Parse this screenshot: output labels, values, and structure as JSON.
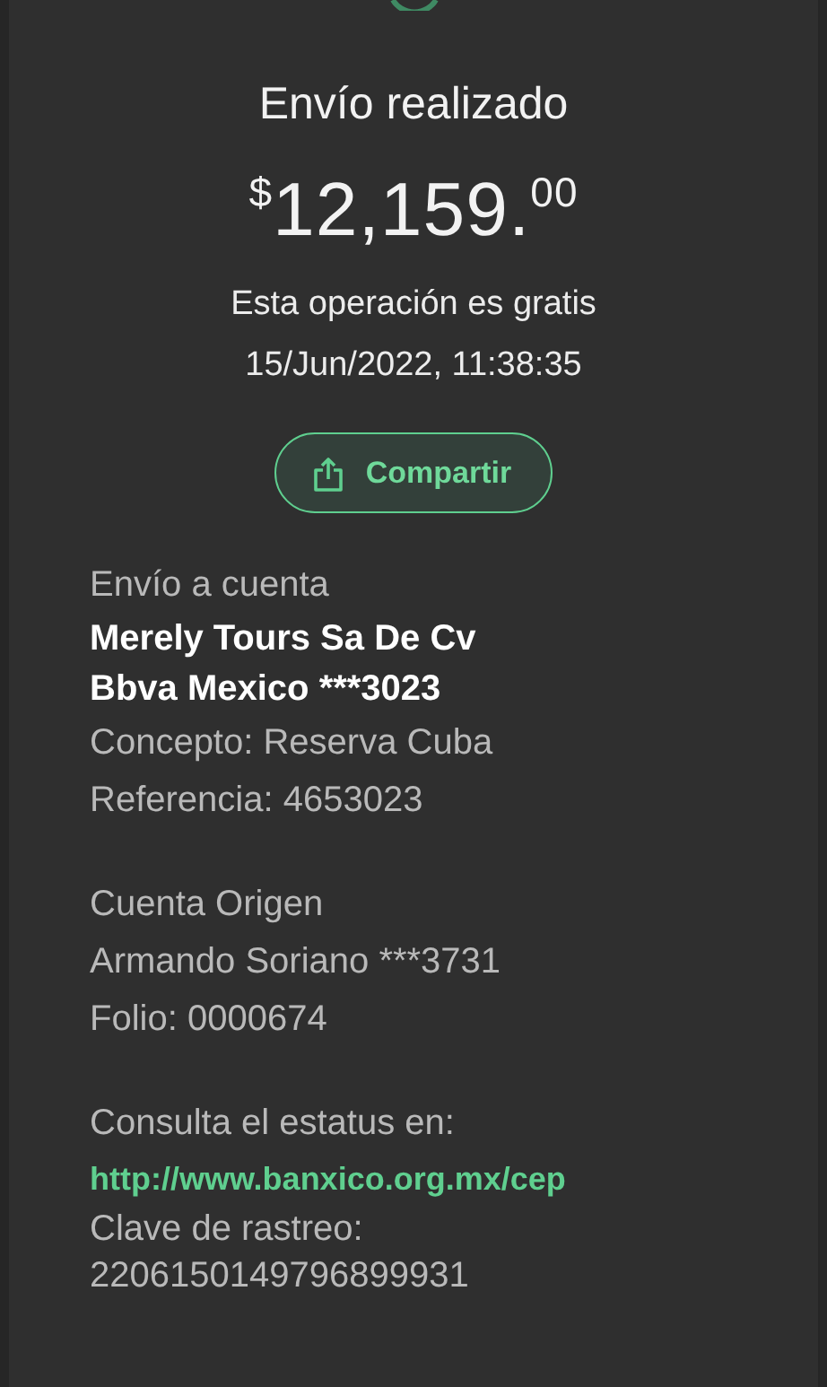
{
  "title": "Envío realizado",
  "amount": {
    "currency": "$",
    "whole": "12,159.",
    "cents": "00"
  },
  "fee_note": "Esta operación es gratis",
  "datetime": "15/Jun/2022, 11:38:35",
  "share_button": "Compartir",
  "sections": [
    {
      "lines": [
        {
          "kind": "label",
          "text": "Envío a cuenta"
        },
        {
          "kind": "bold",
          "text": "Merely Tours Sa De Cv"
        },
        {
          "kind": "bold",
          "text": "Bbva Mexico ***3023"
        },
        {
          "kind": "text",
          "text": "Concepto: Reserva Cuba"
        },
        {
          "kind": "text",
          "text": "Referencia: 4653023"
        }
      ]
    },
    {
      "lines": [
        {
          "kind": "label",
          "text": "Cuenta Origen"
        },
        {
          "kind": "text",
          "text": "Armando Soriano ***3731"
        },
        {
          "kind": "text",
          "text": "Folio: 0000674"
        }
      ]
    },
    {
      "lines": [
        {
          "kind": "label",
          "text": "Consulta el estatus en:"
        },
        {
          "kind": "link",
          "text": "http://www.banxico.org.mx/cep"
        },
        {
          "kind": "text",
          "text": "Clave de rastreo:"
        },
        {
          "kind": "text",
          "text": "2206150149796899931"
        }
      ]
    }
  ]
}
